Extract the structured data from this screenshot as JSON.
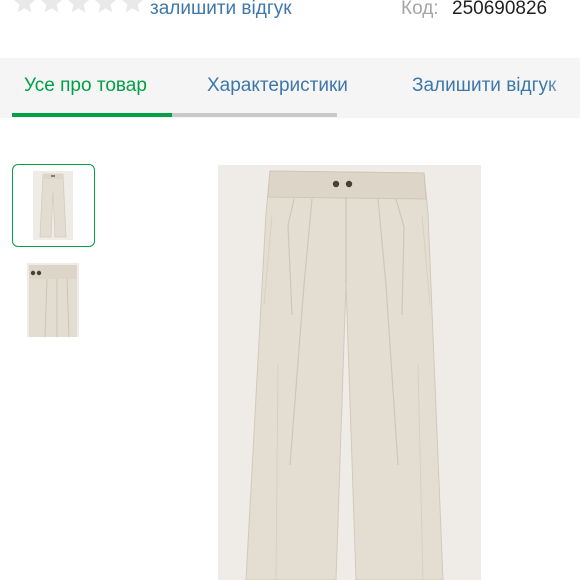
{
  "rating": {
    "stars_filled": 0,
    "stars_total": 5,
    "star_color": "#e9e9e9"
  },
  "review_link": "залишити відгук",
  "product_code": {
    "label": "Код:",
    "value": "250690826"
  },
  "tabs": [
    {
      "label": "Усе про товар",
      "active": true
    },
    {
      "label": "Характеристики",
      "active": false
    },
    {
      "label": "Залишити відгук",
      "active": false
    }
  ],
  "gallery": {
    "thumbnails": [
      {
        "icon": "pants-front-thumbnail",
        "selected": true
      },
      {
        "icon": "pants-detail-thumbnail",
        "selected": false
      }
    ],
    "main_image": "beige-wide-leg-pleated-trousers"
  },
  "colors": {
    "accent_green": "#00a046",
    "link_blue": "#3e77aa",
    "muted_gray": "#a6a5a5",
    "fabric_beige": "#e4ddd2"
  }
}
